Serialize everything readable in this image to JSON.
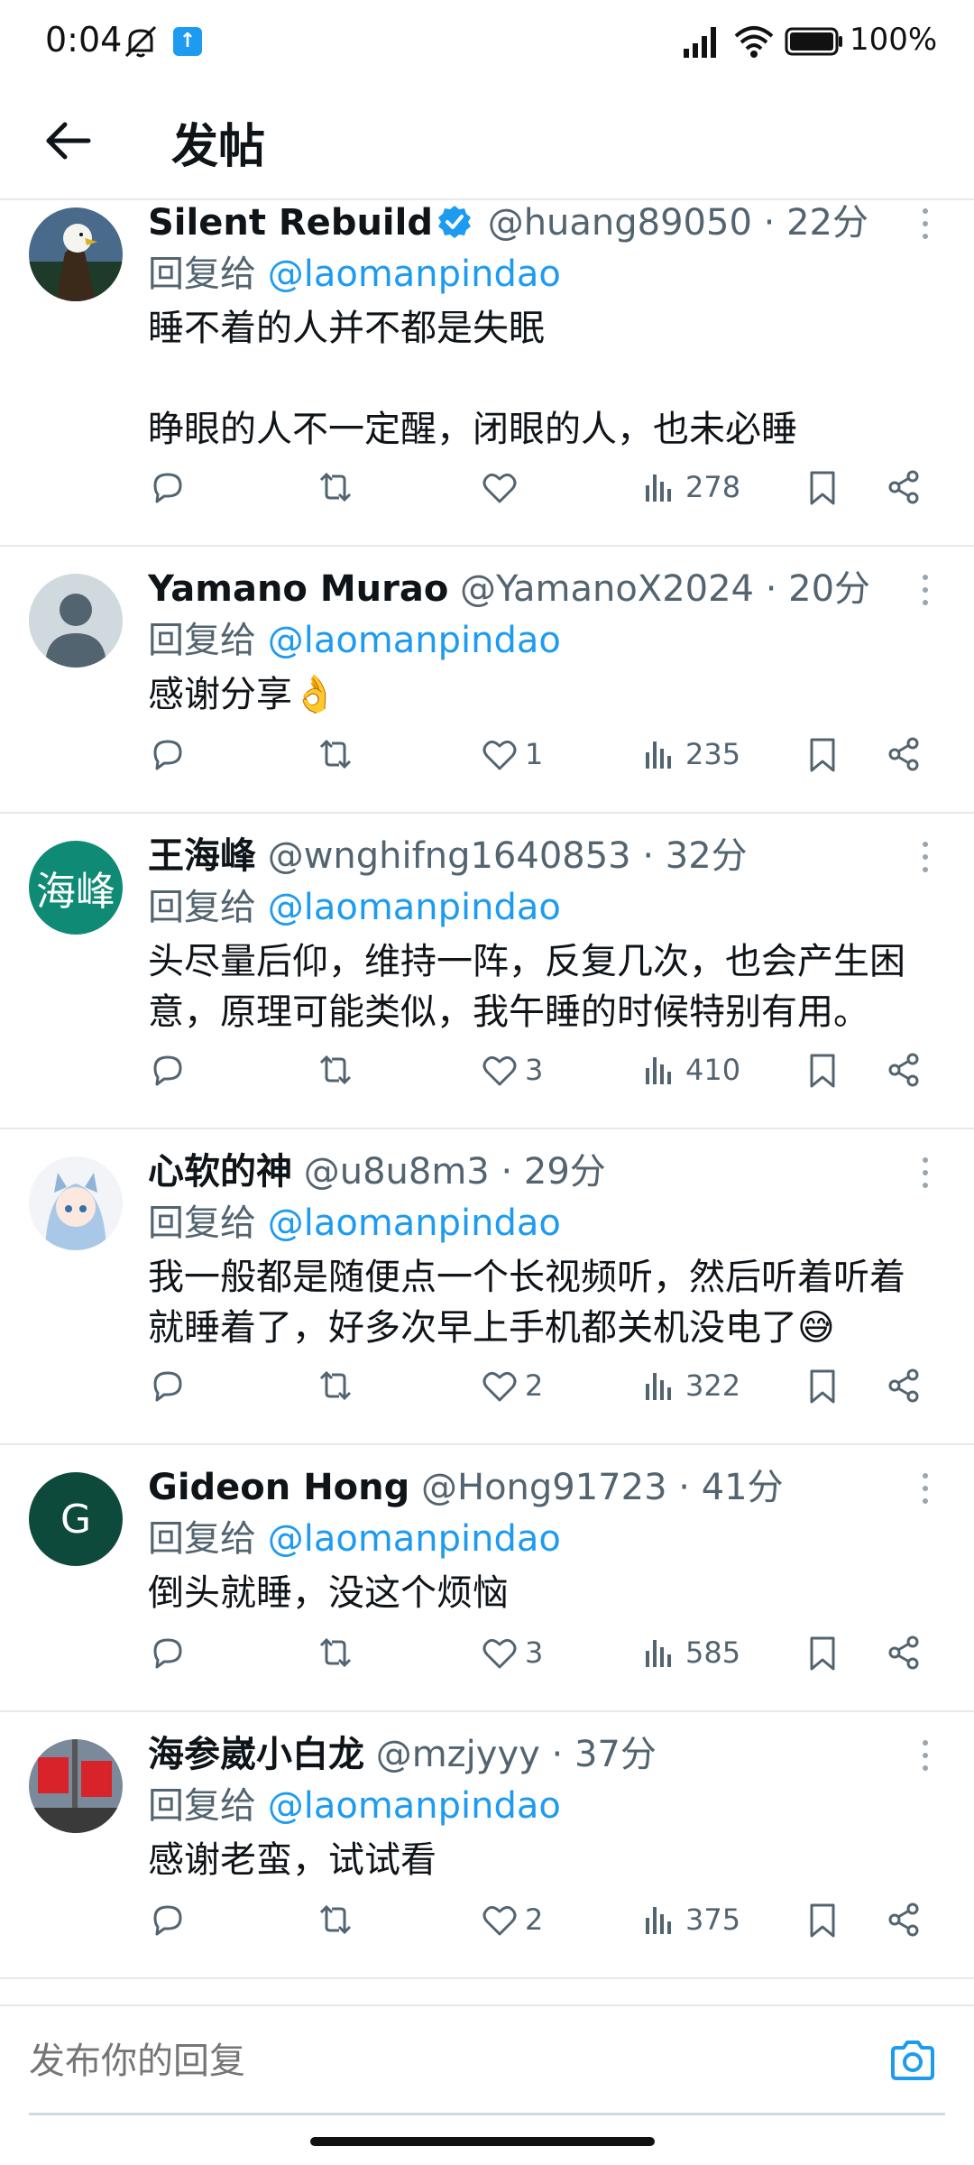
{
  "status_bar": {
    "time": "0:04",
    "battery": "100%",
    "icons": [
      "mute-icon",
      "upload-notification-icon",
      "signal-icon",
      "wifi-icon",
      "battery-icon"
    ]
  },
  "header": {
    "title": "发帖",
    "back_icon": "arrow-left-icon"
  },
  "colors": {
    "accent": "#1d9bf0",
    "text_primary": "#0f1419",
    "text_secondary": "#536471",
    "divider": "#e6e8eb"
  },
  "tweets": [
    {
      "name": "Silent Rebuild",
      "verified": true,
      "handle": "@huang89050",
      "time": "22分",
      "reply_prefix": "回复给",
      "reply_to": "@laomanpindao",
      "body": "睡不着的人并不都是失眠\n\n睁眼的人不一定醒，闭眼的人，也未必睡",
      "likes": "",
      "views": "278",
      "avatar_type": "eagle"
    },
    {
      "name": "Yamano Murao",
      "verified": false,
      "handle": "@YamanoX2024",
      "time": "20分",
      "reply_prefix": "回复给",
      "reply_to": "@laomanpindao",
      "body": "感谢分享👌",
      "likes": "1",
      "views": "235",
      "avatar_type": "default"
    },
    {
      "name": "王海峰",
      "verified": false,
      "handle": "@wnghifng1640853",
      "time": "32分",
      "reply_prefix": "回复给",
      "reply_to": "@laomanpindao",
      "body": "头尽量后仰，维持一阵，反复几次，也会产生困意，原理可能类似，我午睡的时候特别有用。",
      "likes": "3",
      "views": "410",
      "avatar_type": "text",
      "avatar_text": "海峰",
      "avatar_color": "#0f8a74"
    },
    {
      "name": "心软的神",
      "verified": false,
      "handle": "@u8u8m3",
      "time": "29分",
      "reply_prefix": "回复给",
      "reply_to": "@laomanpindao",
      "body": "我一般都是随便点一个长视频听，然后听着听着就睡着了，好多次早上手机都关机没电了😅",
      "likes": "2",
      "views": "322",
      "avatar_type": "anime"
    },
    {
      "name": "Gideon Hong",
      "verified": false,
      "handle": "@Hong91723",
      "time": "41分",
      "reply_prefix": "回复给",
      "reply_to": "@laomanpindao",
      "body": "倒头就睡，没这个烦恼",
      "likes": "3",
      "views": "585",
      "avatar_type": "text",
      "avatar_text": "G",
      "avatar_color": "#0e4a3b"
    },
    {
      "name": "海参崴小白龙",
      "verified": false,
      "handle": "@mzjyyy",
      "time": "37分",
      "reply_prefix": "回复给",
      "reply_to": "@laomanpindao",
      "body": "感谢老蛮，试试看",
      "likes": "2",
      "views": "375",
      "avatar_type": "flags"
    }
  ],
  "composer": {
    "placeholder": "发布你的回复",
    "camera_icon": "camera-icon"
  }
}
